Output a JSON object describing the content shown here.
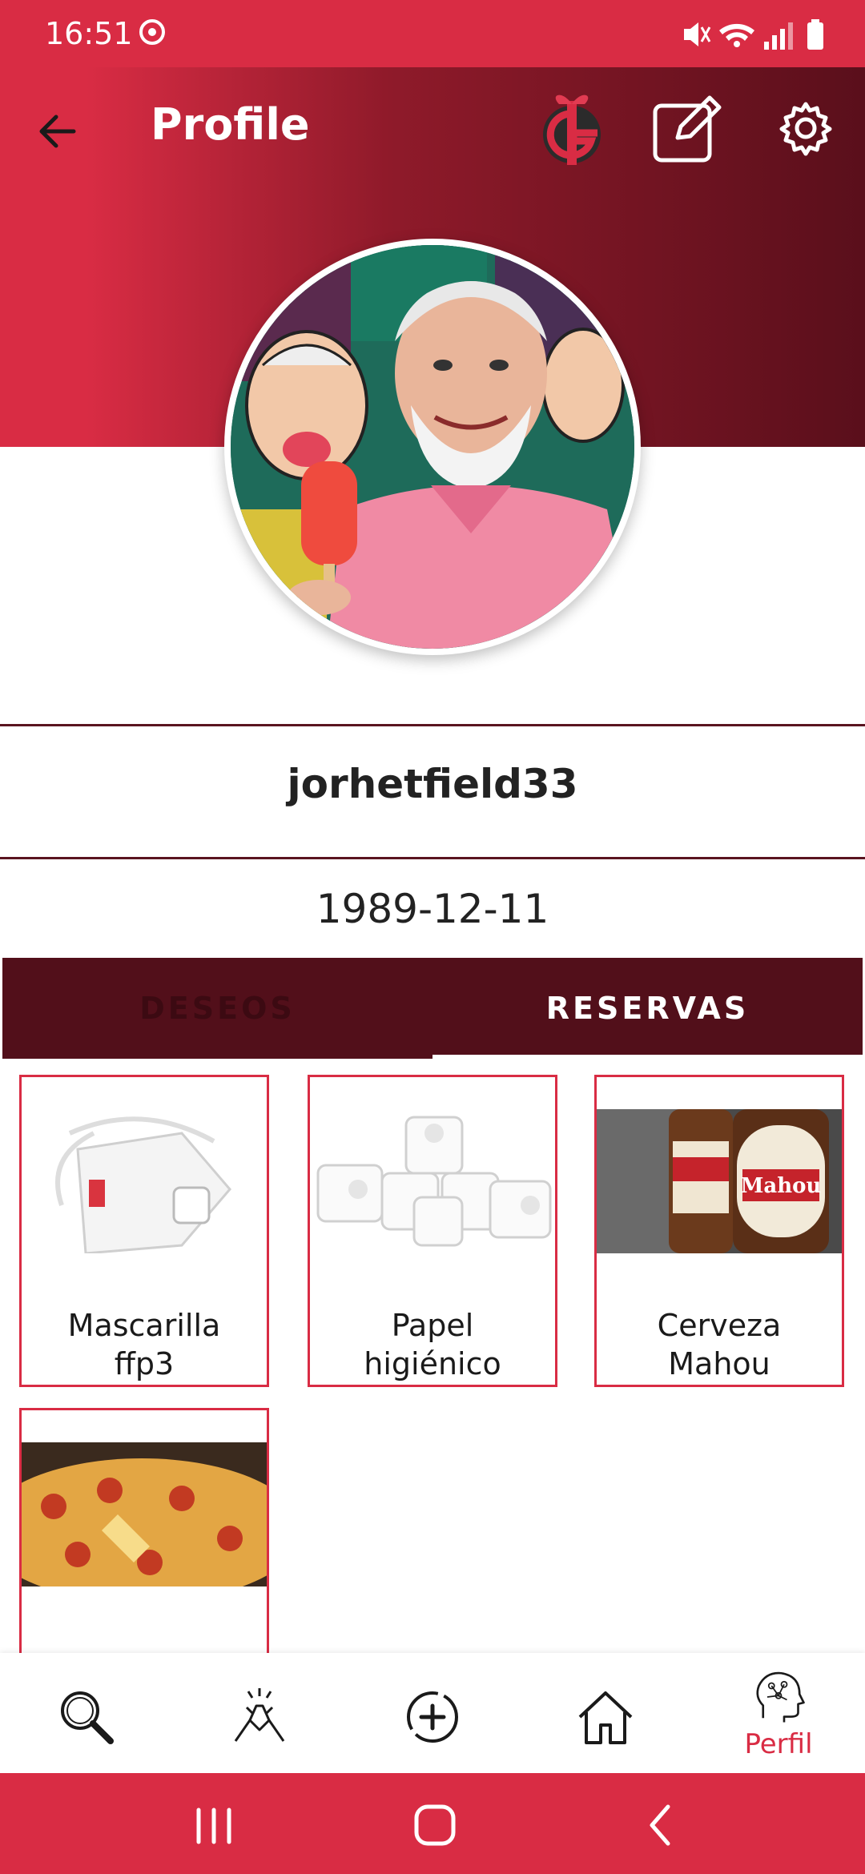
{
  "status_bar": {
    "time": "16:51"
  },
  "header": {
    "title": "Profile"
  },
  "profile": {
    "username": "jorhetfield33",
    "birthdate": "1989-12-11"
  },
  "tabs": [
    {
      "label": "DESEOS",
      "active": false
    },
    {
      "label": "RESERVAS",
      "active": true
    }
  ],
  "reservations": [
    {
      "line1": "Mascarilla",
      "line2": "ffp3",
      "image": "mask-icon"
    },
    {
      "line1": "Papel",
      "line2": "higiénico",
      "image": "toilet-paper-icon"
    },
    {
      "line1": "Cerveza",
      "line2": "Mahou",
      "image": "beer-bottles-icon"
    },
    {
      "line1": "",
      "line2": "",
      "image": "pizza-icon"
    }
  ],
  "bottom_nav": [
    {
      "icon": "search-icon",
      "label": ""
    },
    {
      "icon": "handshake-icon",
      "label": ""
    },
    {
      "icon": "add-circle-icon",
      "label": ""
    },
    {
      "icon": "home-icon",
      "label": ""
    },
    {
      "icon": "profile-head-icon",
      "label": "Perfil",
      "active": true
    }
  ],
  "colors": {
    "primary": "#d92c44",
    "dark": "#520f1a",
    "accent": "#d92c44"
  }
}
